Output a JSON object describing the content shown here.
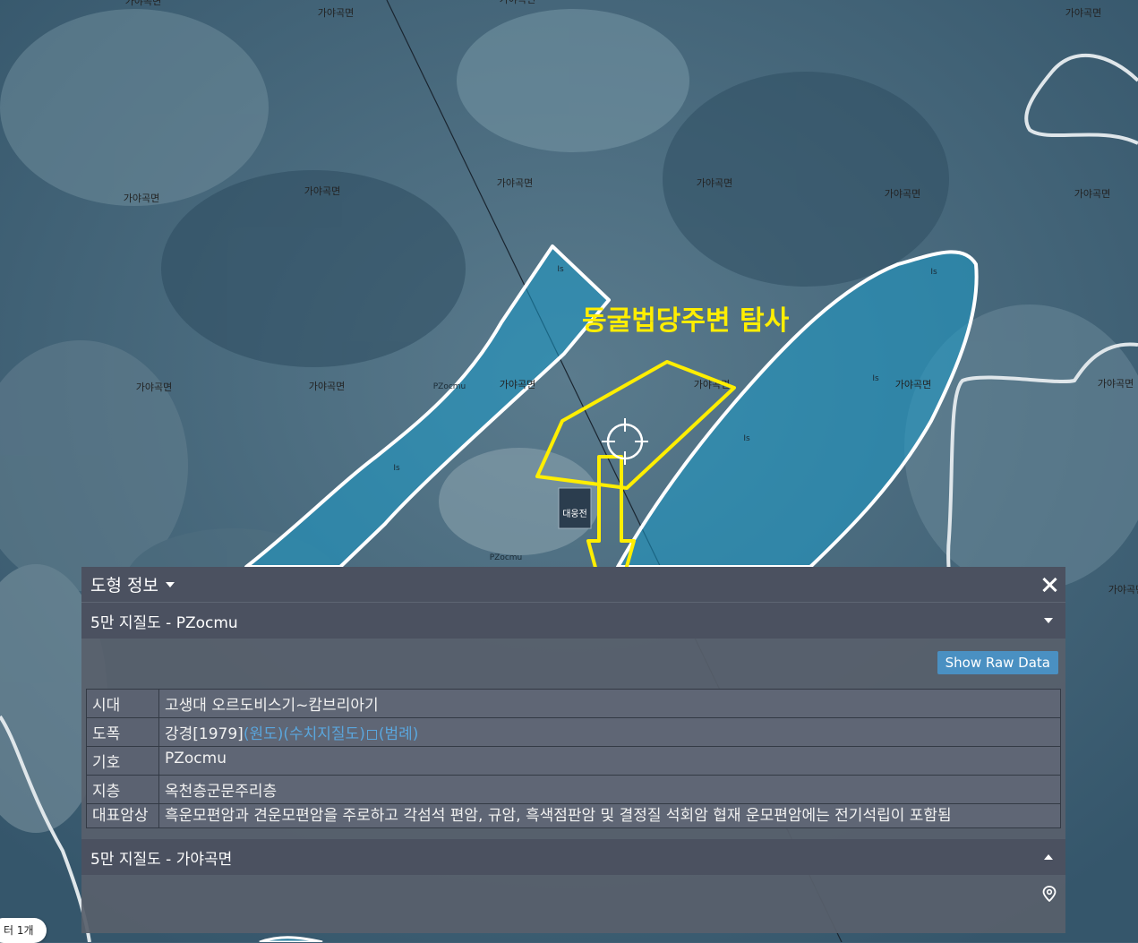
{
  "map": {
    "area_labels": [
      "가야곡면",
      "가야곡면",
      "가야곡면",
      "가야곡면",
      "가야곡면",
      "가야곡면",
      "가야곡면",
      "가야곡면",
      "가야곡면",
      "가야곡면",
      "가야곡면",
      "가야곡면",
      "가야곡면",
      "가야곡면",
      "가야곡면",
      "가야곡면",
      "가야곡면"
    ],
    "geo_codes": [
      "PZocmu",
      "PZocmu",
      "Is",
      "Is",
      "Is",
      "Is",
      "Is"
    ],
    "building_label": "대웅전",
    "annotation_text": "동굴법당주변 탐사",
    "colors": {
      "polygon_fill": "#1b9ac8",
      "polygon_stroke": "#ffffff",
      "annotation": "#ffee00"
    }
  },
  "counter": {
    "label": "터 1개"
  },
  "panel": {
    "title": "도형 정보",
    "sections": [
      {
        "title": "5만 지질도 - PZocmu",
        "raw_button": "Show Raw Data",
        "rows": [
          {
            "key": "시대",
            "value": "고생대 오르도비스기~캄브리아기"
          },
          {
            "key": "도폭",
            "value": "강경[1979]",
            "links": [
              "(원도)",
              "(수치지질도)",
              "(범례)"
            ]
          },
          {
            "key": "기호",
            "value": "PZocmu"
          },
          {
            "key": "지층",
            "value": "옥천층군문주리층"
          },
          {
            "key": "대표암상",
            "value": "흑운모편암과 견운모편암을 주로하고 각섬석 편암, 규암, 흑색점판암 및 결정질 석회암 협재 운모편암에는 전기석립이 포함됨"
          }
        ]
      },
      {
        "title": "5만 지질도 - 가야곡면"
      }
    ]
  }
}
